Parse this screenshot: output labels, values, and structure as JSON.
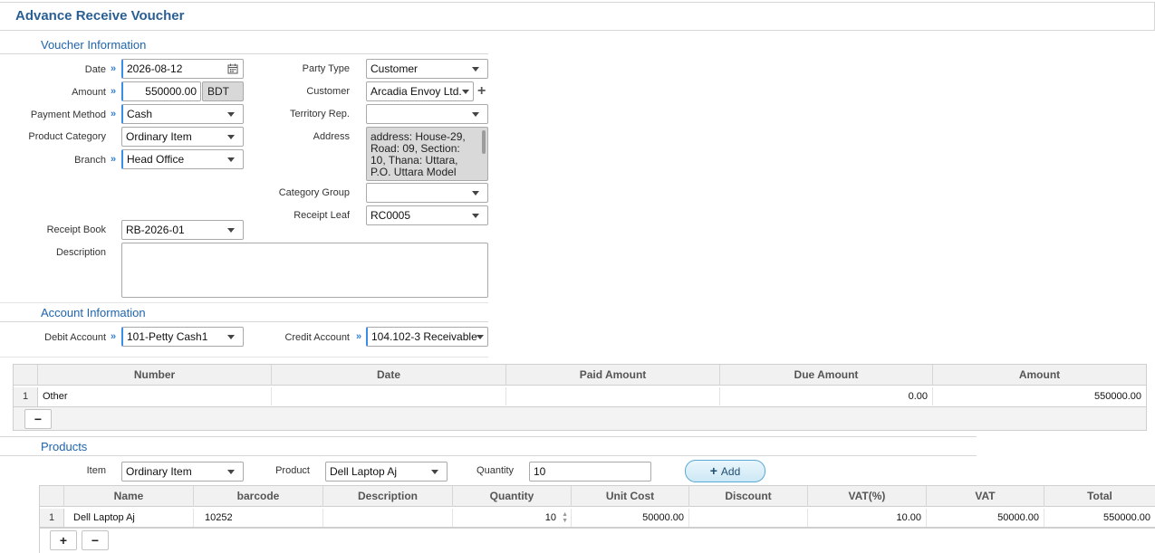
{
  "title": "Advance Receive Voucher",
  "voucher_info": {
    "heading": "Voucher Information",
    "date_label": "Date",
    "date_value": "2026-08-12",
    "amount_label": "Amount",
    "amount_value": "550000.00",
    "currency": "BDT",
    "payment_method_label": "Payment Method",
    "payment_method_value": "Cash",
    "product_category_label": "Product Category",
    "product_category_value": "Ordinary Item",
    "branch_label": "Branch",
    "branch_value": "Head Office",
    "party_type_label": "Party Type",
    "party_type_value": "Customer",
    "customer_label": "Customer",
    "customer_value": "Arcadia Envoy Ltd.",
    "territory_rep_label": "Territory Rep.",
    "territory_rep_value": "",
    "address_label": "Address",
    "address_value": "address: House-29, Road: 09, Section: 10, Thana: Uttara, P.O. Uttara Model",
    "category_group_label": "Category Group",
    "category_group_value": "",
    "receipt_leaf_label": "Receipt Leaf",
    "receipt_leaf_value": "RC0005",
    "receipt_book_label": "Receipt Book",
    "receipt_book_value": "RB-2026-01",
    "description_label": "Description",
    "description_value": ""
  },
  "account_info": {
    "heading": "Account Information",
    "debit_label": "Debit Account",
    "debit_value": "101-Petty Cash1",
    "credit_label": "Credit Account",
    "credit_value": "104.102-3 Receivable"
  },
  "payment_grid": {
    "headers": [
      "Number",
      "Date",
      "Paid Amount",
      "Due Amount",
      "Amount"
    ],
    "rows": [
      {
        "num": "1",
        "number": "Other",
        "date": "",
        "paid": "",
        "due": "0.00",
        "amount": "550000.00"
      }
    ],
    "remove_label": "−"
  },
  "products": {
    "heading": "Products",
    "item_label": "Item",
    "item_value": "Ordinary Item",
    "product_label": "Product",
    "product_value": "Dell Laptop Aj",
    "quantity_label": "Quantity",
    "quantity_value": "10",
    "add_label": "Add",
    "headers": [
      "Name",
      "barcode",
      "Description",
      "Quantity",
      "Unit Cost",
      "Discount",
      "VAT(%)",
      "VAT",
      "Total"
    ],
    "rows": [
      {
        "num": "1",
        "name": "Dell Laptop Aj",
        "barcode": "10252",
        "description": "",
        "quantity": "10",
        "unit_cost": "50000.00",
        "discount": "",
        "vat_pct": "10.00",
        "vat": "50000.00",
        "total": "550000.00"
      }
    ],
    "add_row_label": "+",
    "remove_row_label": "−"
  }
}
